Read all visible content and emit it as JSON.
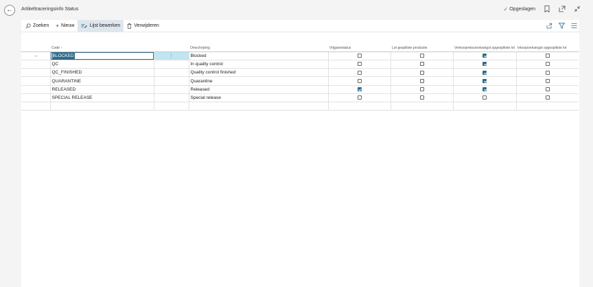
{
  "header": {
    "title": "Artikeltraceringsinfo Status",
    "saved_label": "Opgeslagen"
  },
  "toolbar": {
    "search_label": "Zoeken",
    "new_label": "Nieuw",
    "edit_list_label": "Lijst bewerken",
    "delete_label": "Verwijderen"
  },
  "columns": {
    "code": "Code ↑",
    "description": "Omschrijving",
    "release_status": "Vrijgavestatus",
    "lot_split_production": "Lot gesplitste productie",
    "sales_return_split_lot": "Verkoopretourontvangst opgesplitste lot",
    "purchase_receipt_split_lot": "Inkoopontvangst opgesplitste lot"
  },
  "rows": [
    {
      "code": "BLOCKED",
      "description": "Blocked",
      "release": false,
      "lot_split": false,
      "sales_return": true,
      "purchase": false,
      "selected": true
    },
    {
      "code": "QC",
      "description": "In quality control",
      "release": false,
      "lot_split": false,
      "sales_return": true,
      "purchase": false
    },
    {
      "code": "QC_FINISHED",
      "description": "Quality control finished",
      "release": false,
      "lot_split": false,
      "sales_return": true,
      "purchase": false
    },
    {
      "code": "QUARANTINE",
      "description": "Quarantine",
      "release": false,
      "lot_split": false,
      "sales_return": true,
      "purchase": false
    },
    {
      "code": "RELEASED",
      "description": "Released",
      "release": true,
      "lot_split": false,
      "sales_return": true,
      "purchase": false
    },
    {
      "code": "SPECIAL RELEASE",
      "description": "Special release",
      "release": false,
      "lot_split": false,
      "sales_return": false,
      "purchase": false
    }
  ],
  "icons": {
    "back": "arrow-left-icon",
    "search": "search-icon",
    "new": "plus-icon",
    "edit_list": "edit-list-icon",
    "delete": "trash-icon",
    "bookmark": "bookmark-icon",
    "open_new_window": "open-new-window-icon",
    "collapse": "collapse-icon",
    "share": "share-icon",
    "filter": "filter-icon",
    "list_view": "list-view-icon",
    "row_indicator": "arrow-right-icon",
    "row_menu": "more-vertical-icon"
  },
  "colors": {
    "accent": "#2e6b8a",
    "selection_cell": "#bfe6f2",
    "active_toolbar": "#dfe6ee"
  }
}
